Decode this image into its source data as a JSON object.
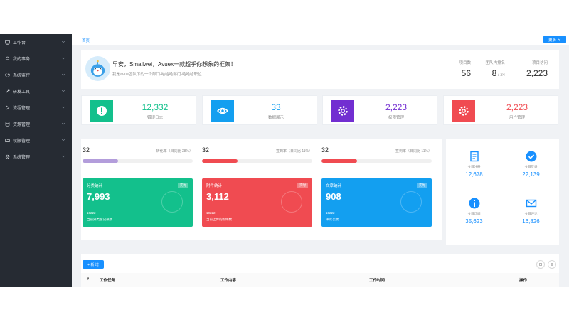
{
  "colors": {
    "primary": "#1890ff",
    "sidebar_bg": "#262b33",
    "green": "#13c08c",
    "blue": "#139ff0",
    "purple": "#722ed1",
    "red": "#f04b51",
    "lavender": "#b39ddb"
  },
  "sidebar": {
    "items": [
      {
        "label": "工作台",
        "icon": "monitor-icon"
      },
      {
        "label": "我的事务",
        "icon": "bell-icon"
      },
      {
        "label": "系统监控",
        "icon": "gauge-icon"
      },
      {
        "label": "研发工具",
        "icon": "wrench-icon"
      },
      {
        "label": "流程管理",
        "icon": "flow-icon"
      },
      {
        "label": "资源管理",
        "icon": "database-icon"
      },
      {
        "label": "权限管理",
        "icon": "folder-icon"
      },
      {
        "label": "系统管理",
        "icon": "gear-icon"
      }
    ]
  },
  "tabs": {
    "home": "首页",
    "more": "更多"
  },
  "welcome": {
    "title": "早安，Smallwei，Avuex一款超乎你想象的框架！",
    "subtitle": "我是avue团队下的一个部门-哈哈哈部门-哈哈哈职位",
    "stats": [
      {
        "label": "项目数",
        "value": "56",
        "suffix": ""
      },
      {
        "label": "团队内排名",
        "value": "8",
        "suffix": " / 24"
      },
      {
        "label": "项目访问",
        "value": "2,223",
        "suffix": ""
      }
    ]
  },
  "metrics": [
    {
      "value": "12,332",
      "label": "错误日志",
      "icon": "exclamation-icon",
      "color": "#13c08c"
    },
    {
      "value": "33",
      "label": "数据展示",
      "icon": "eye-icon",
      "color": "#139ff0"
    },
    {
      "value": "2,223",
      "label": "权限管理",
      "icon": "gear-icon",
      "color": "#722ed1"
    },
    {
      "value": "2,223",
      "label": "用户管理",
      "icon": "gear-icon",
      "color": "#f04b51"
    }
  ],
  "progress": [
    {
      "value": "32",
      "label": "转化率（日同比 28%）",
      "percent": 32,
      "color": "#b39ddb"
    },
    {
      "value": "32",
      "label": "签到率（日同比 11%）",
      "percent": 32,
      "color": "#f04b51"
    },
    {
      "value": "32",
      "label": "签到率（日同比 11%）",
      "percent": 32,
      "color": "#f04b51"
    }
  ],
  "panels": [
    {
      "title": "分类统计",
      "badge": "实时",
      "value": "7,993",
      "small": "10222",
      "desc": "当前分类总记录数",
      "color": "#13c08c"
    },
    {
      "title": "附件统计",
      "badge": "实时",
      "value": "3,112",
      "small": "10222",
      "desc": "当前上传的附件数",
      "color": "#f04b51"
    },
    {
      "title": "文章统计",
      "badge": "实时",
      "value": "908",
      "small": "10222",
      "desc": "评论次数",
      "color": "#139ff0"
    }
  ],
  "right_stats": [
    {
      "label": "今日注册",
      "value": "12,678",
      "icon": "document-icon"
    },
    {
      "label": "今日登录",
      "value": "22,139",
      "icon": "check-circle-icon"
    },
    {
      "label": "今日订阅",
      "value": "35,623",
      "icon": "info-icon"
    },
    {
      "label": "今日评论",
      "value": "16,826",
      "icon": "envelope-icon"
    }
  ],
  "table": {
    "add_label": "+ 新 增",
    "headers": [
      "#",
      "工作任务",
      "工作内容",
      "工作时间",
      "操作"
    ]
  }
}
